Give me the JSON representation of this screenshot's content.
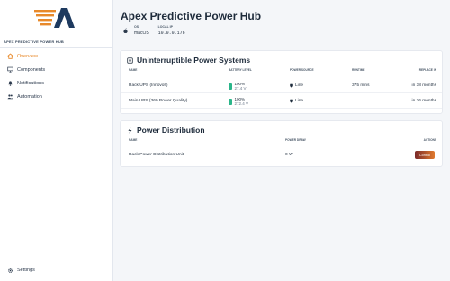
{
  "app": {
    "hub_name": "Apex Predictive Power Hub",
    "page_title": "Apex Predictive Power Hub",
    "accent_color": "#e8892a"
  },
  "sidebar": {
    "items": [
      {
        "label": "Overview",
        "icon": "home-icon",
        "active": true
      },
      {
        "label": "Components",
        "icon": "monitor-icon",
        "active": false
      },
      {
        "label": "Notifications",
        "icon": "bell-icon",
        "active": false
      },
      {
        "label": "Automation",
        "icon": "people-icon",
        "active": false
      }
    ],
    "settings_label": "Settings"
  },
  "info": {
    "os_label": "OS",
    "os_value": "macOS",
    "local_ip_label": "Local IP",
    "local_ip_value": "10.0.0.176"
  },
  "ups": {
    "title": "Uninterruptible Power Systems",
    "columns": [
      "Name",
      "Battery Level",
      "Power Source",
      "Runtime",
      "Replace In"
    ],
    "rows": [
      {
        "name": "Rack UPS (Innovolt)",
        "battery": "100%",
        "voltage": "27.4 V",
        "source": "Line",
        "runtime": "375 mins",
        "replace": "in 38 months"
      },
      {
        "name": "Main UPS (360 Power Quality)",
        "battery": "100%",
        "voltage": "272.4 V",
        "source": "Line",
        "runtime": "",
        "replace": "in 36 months"
      }
    ]
  },
  "pdu": {
    "title": "Power Distribution",
    "columns": [
      "Name",
      "Power Draw",
      "Actions"
    ],
    "rows": [
      {
        "name": "Rack Power Distribution Unit",
        "draw": "0 W",
        "action": "Control"
      }
    ]
  }
}
